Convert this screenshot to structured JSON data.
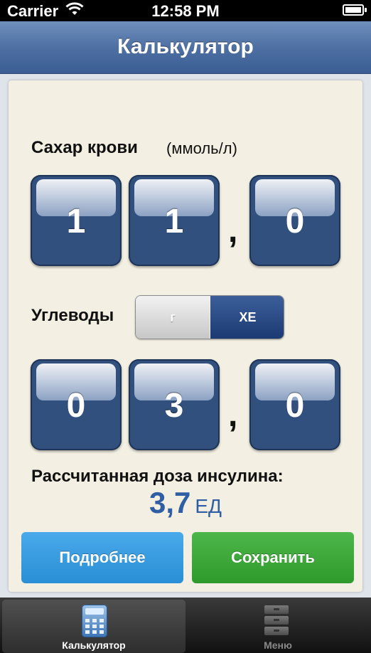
{
  "status_bar": {
    "carrier": "Carrier",
    "time": "12:58 PM"
  },
  "nav": {
    "title": "Калькулятор"
  },
  "blood_sugar": {
    "label": "Сахар крови",
    "unit": "(ммоль/л)",
    "digits": [
      "1",
      "1",
      "0"
    ],
    "separator": ","
  },
  "carbs": {
    "label": "Углеводы",
    "segment_options": [
      "г",
      "ХЕ"
    ],
    "selected": "ХЕ",
    "digits": [
      "0",
      "3",
      "0"
    ],
    "separator": ","
  },
  "result": {
    "label": "Рассчитанная доза инсулина:",
    "value": "3,7",
    "unit": "ЕД"
  },
  "buttons": {
    "details": "Подробнее",
    "save": "Сохранить"
  },
  "tabs": [
    {
      "label": "Калькулятор",
      "active": true,
      "icon": "calculator-icon"
    },
    {
      "label": "Меню",
      "active": false,
      "icon": "menu-icon"
    }
  ],
  "colors": {
    "accent": "#2f5ea5",
    "details_button": "#2a8fd6",
    "save_button": "#2f9a2c",
    "digit_bg": "#31507e"
  }
}
